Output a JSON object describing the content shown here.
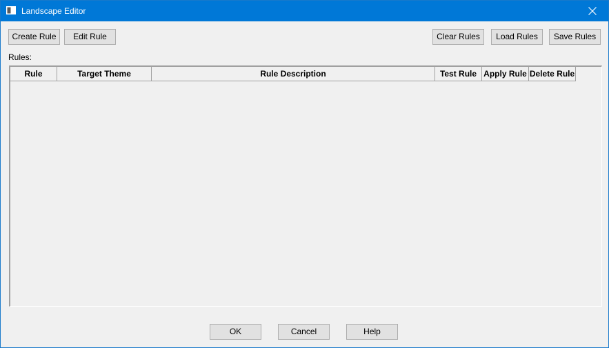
{
  "window": {
    "title": "Landscape Editor",
    "app_icon": "window-icon",
    "close_icon": "close-icon"
  },
  "toolbar": {
    "create_rule_label": "Create Rule",
    "edit_rule_label": "Edit Rule",
    "clear_rules_label": "Clear Rules",
    "load_rules_label": "Load Rules",
    "save_rules_label": "Save Rules"
  },
  "rules": {
    "label": "Rules:",
    "columns": [
      "Rule",
      "Target Theme",
      "Rule Description",
      "Test Rule",
      "Apply Rule",
      "Delete Rule"
    ],
    "rows": []
  },
  "footer": {
    "ok_label": "OK",
    "cancel_label": "Cancel",
    "help_label": "Help"
  },
  "colors": {
    "titlebar": "#0078d7",
    "window_background": "#f0f0f0",
    "button_background": "#e1e1e1",
    "button_border": "#adadad"
  }
}
